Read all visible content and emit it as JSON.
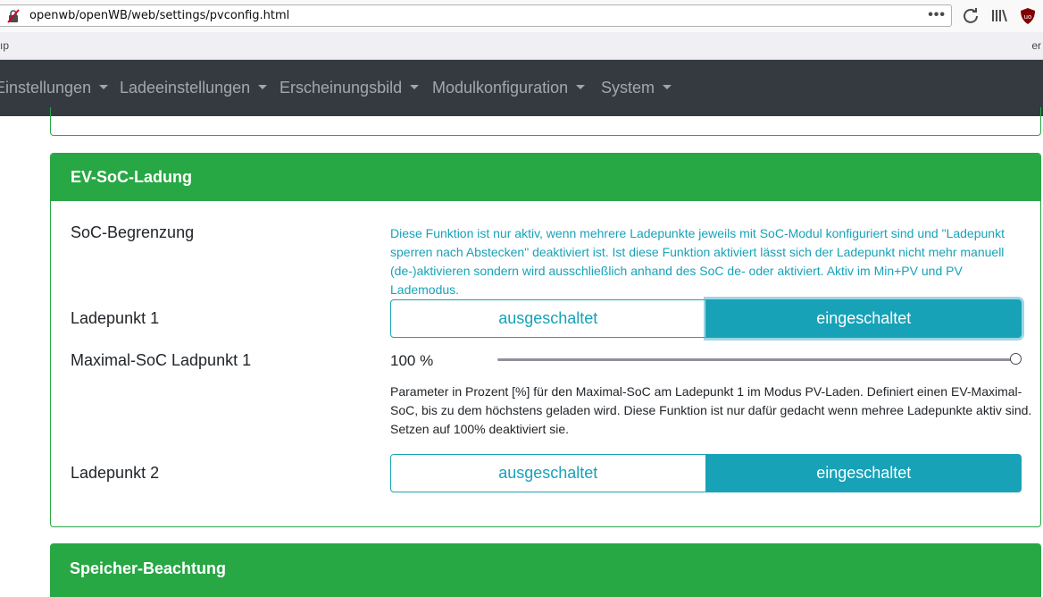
{
  "browser": {
    "url": "openwb/openWB/web/settings/pvconfig.html",
    "page_actions_icon": "more-icon",
    "bookmarks_left_text": "ıp",
    "bookmarks_right_text": "er"
  },
  "navbar": {
    "items": [
      {
        "label": "Einstellungen"
      },
      {
        "label": "Ladeeinstellungen"
      },
      {
        "label": "Erscheinungsbild"
      },
      {
        "label": "Modulkonfiguration"
      },
      {
        "label": "System"
      }
    ]
  },
  "ev_soc_card": {
    "title": "EV-SoC-Ladung",
    "soc_limit_label": "SoC-Begrenzung",
    "soc_limit_info": "Diese Funktion ist nur aktiv, wenn mehrere Ladepunkte jeweils mit SoC-Modul konfiguriert sind und \"Ladepunkt sperren nach Abstecken\" deaktiviert ist. Ist diese Funktion aktiviert lässt sich der Ladepunkt nicht mehr manuell (de-)aktivieren sondern wird ausschließlich anhand des SoC de- oder aktiviert. Aktiv im Min+PV und PV Lademodus.",
    "lp1_label": "Ladepunkt 1",
    "lp1_off": "ausgeschaltet",
    "lp1_on": "eingeschaltet",
    "max_soc_label": "Maximal-SoC Ladpunkt 1",
    "max_soc_value": "100 %",
    "max_soc_fraction": 1.0,
    "max_soc_info": "Parameter in Prozent [%] für den Maximal-SoC am Ladepunkt 1 im Modus PV-Laden. Definiert einen EV-Maximal-SoC, bis zu dem höchstens geladen wird. Diese Funktion ist nur dafür gedacht wenn mehree Ladepunkte aktiv sind. Setzen auf 100% deaktiviert sie.",
    "lp2_label": "Ladepunkt 2",
    "lp2_off": "ausgeschaltet",
    "lp2_on": "eingeschaltet"
  },
  "next_card": {
    "title": "Speicher-Beachtung"
  },
  "colors": {
    "green": "#28a745",
    "teal": "#17a2b8",
    "navbar": "#343a40"
  }
}
